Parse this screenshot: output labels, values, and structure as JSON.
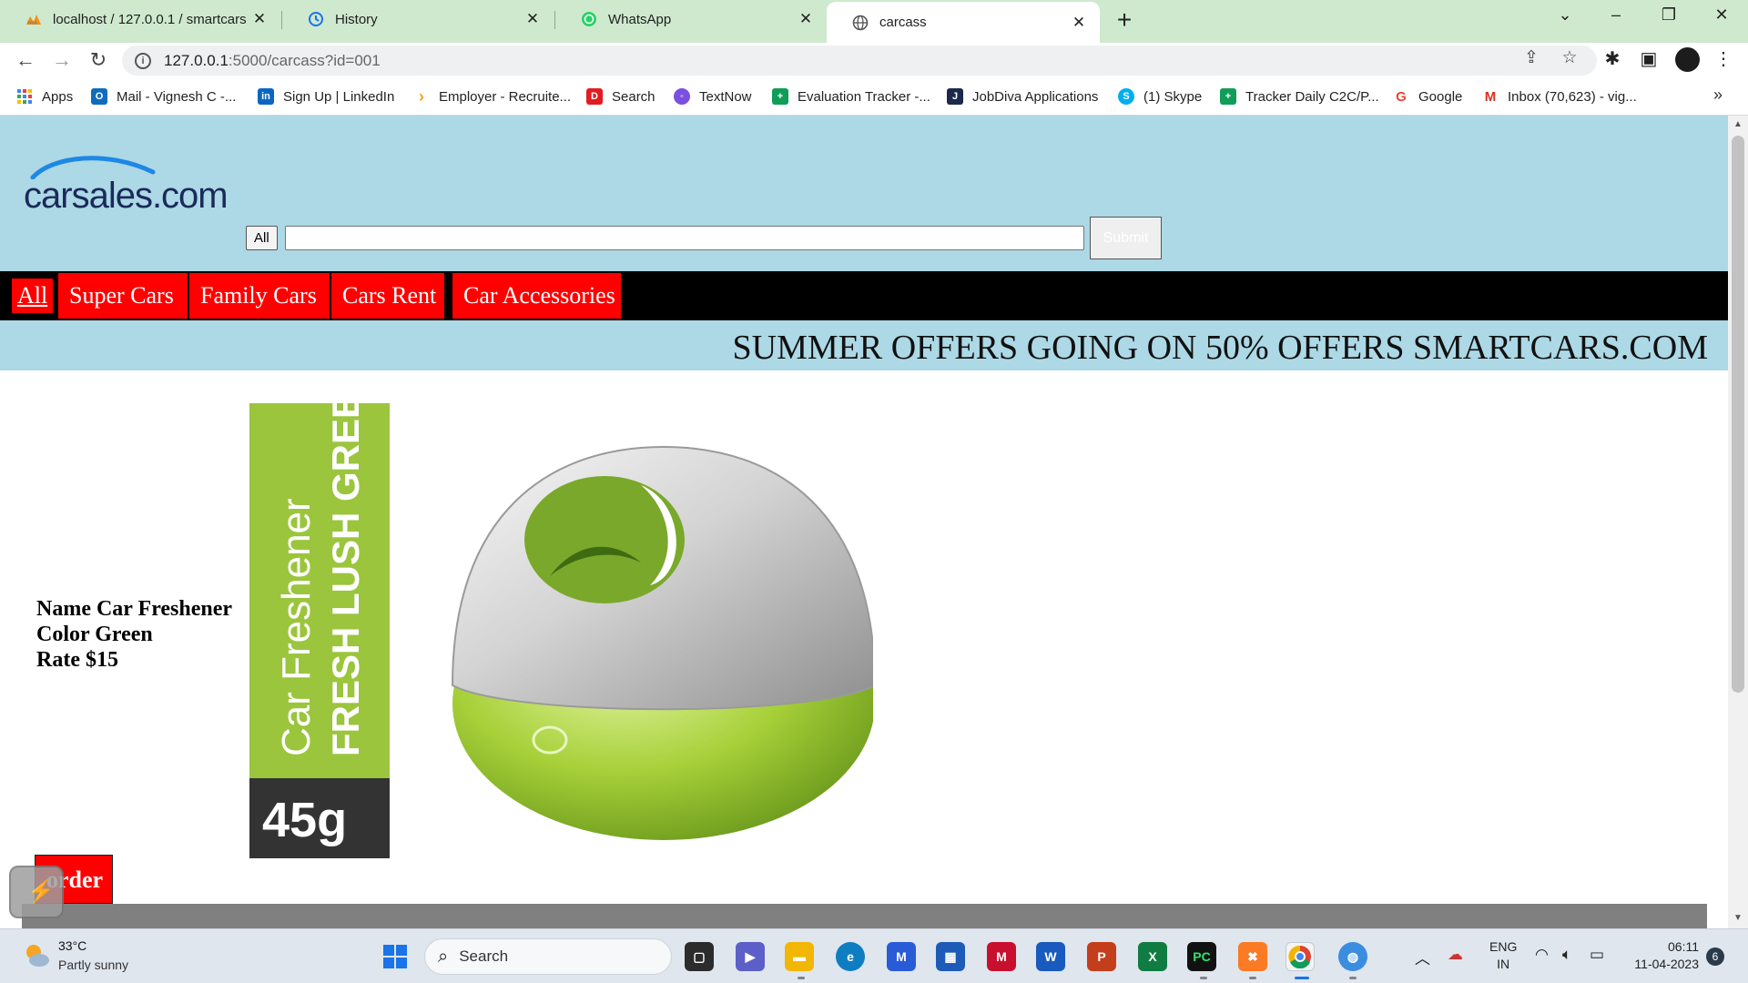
{
  "browser": {
    "tabs": [
      {
        "label": "localhost / 127.0.0.1 / smartcars |",
        "icon": "phpmyadmin-icon",
        "active": false
      },
      {
        "label": "History",
        "icon": "history-icon",
        "active": false
      },
      {
        "label": "WhatsApp",
        "icon": "whatsapp-icon",
        "active": false
      },
      {
        "label": "carcass",
        "icon": "globe-icon",
        "active": true
      }
    ],
    "url_host": "127.0.0.1",
    "url_path": ":5000/carcass?id=001",
    "bookmarks": [
      {
        "label": "Apps",
        "icon": "apps-grid-icon",
        "color": "#4285f4"
      },
      {
        "label": "Mail - Vignesh C -...",
        "icon": "outlook-icon",
        "color": "#0f6cbd"
      },
      {
        "label": "Sign Up | LinkedIn",
        "icon": "linkedin-icon",
        "color": "#0a66c2"
      },
      {
        "label": "Employer - Recruite...",
        "icon": "employer-icon",
        "color": "#f7a21b"
      },
      {
        "label": "Search",
        "icon": "dice-search-icon",
        "color": "#e31b23"
      },
      {
        "label": "TextNow",
        "icon": "textnow-icon",
        "color": "#7b4fe0"
      },
      {
        "label": "Evaluation Tracker -...",
        "icon": "sheets-icon",
        "color": "#0f9d58"
      },
      {
        "label": "JobDiva Applications",
        "icon": "jobdiva-icon",
        "color": "#1b2a4a"
      },
      {
        "label": "(1) Skype",
        "icon": "skype-icon",
        "color": "#00aff0"
      },
      {
        "label": "Tracker Daily C2C/P...",
        "icon": "sheets-icon",
        "color": "#0f9d58"
      },
      {
        "label": "Google",
        "icon": "google-icon",
        "color": "#ea4335"
      },
      {
        "label": "Inbox (70,623) - vig...",
        "icon": "gmail-icon",
        "color": "#d93025"
      }
    ]
  },
  "site": {
    "logo_text": "carsales.com",
    "category_select": "All",
    "search_value": "",
    "submit_label": "Submit",
    "nav": [
      "All",
      "Super Cars",
      "Family Cars",
      "Cars Rent",
      "Car Accessories"
    ],
    "offer_banner": "SUMMER OFFERS GOING ON 50% OFFERS SMARTCARS.COM",
    "product": {
      "name_line": "Name Car Freshener",
      "color_line": "Color Green",
      "rate_line": "Rate $15",
      "package_brand": "Car Freshener",
      "package_variant": "FRESH LUSH GREEN",
      "package_weight": "45g"
    },
    "order_label": "order",
    "colors": {
      "header_bg": "#add8e6",
      "nav_bg": "#000000",
      "nav_item_bg": "#ff0000",
      "product_green": "#9bc53d"
    }
  },
  "taskbar": {
    "weather_temp": "33°C",
    "weather_desc": "Partly sunny",
    "search_label": "Search",
    "lang_top": "ENG",
    "lang_bottom": "IN",
    "time": "06:11",
    "date": "11-04-2023",
    "notifications": "6"
  }
}
